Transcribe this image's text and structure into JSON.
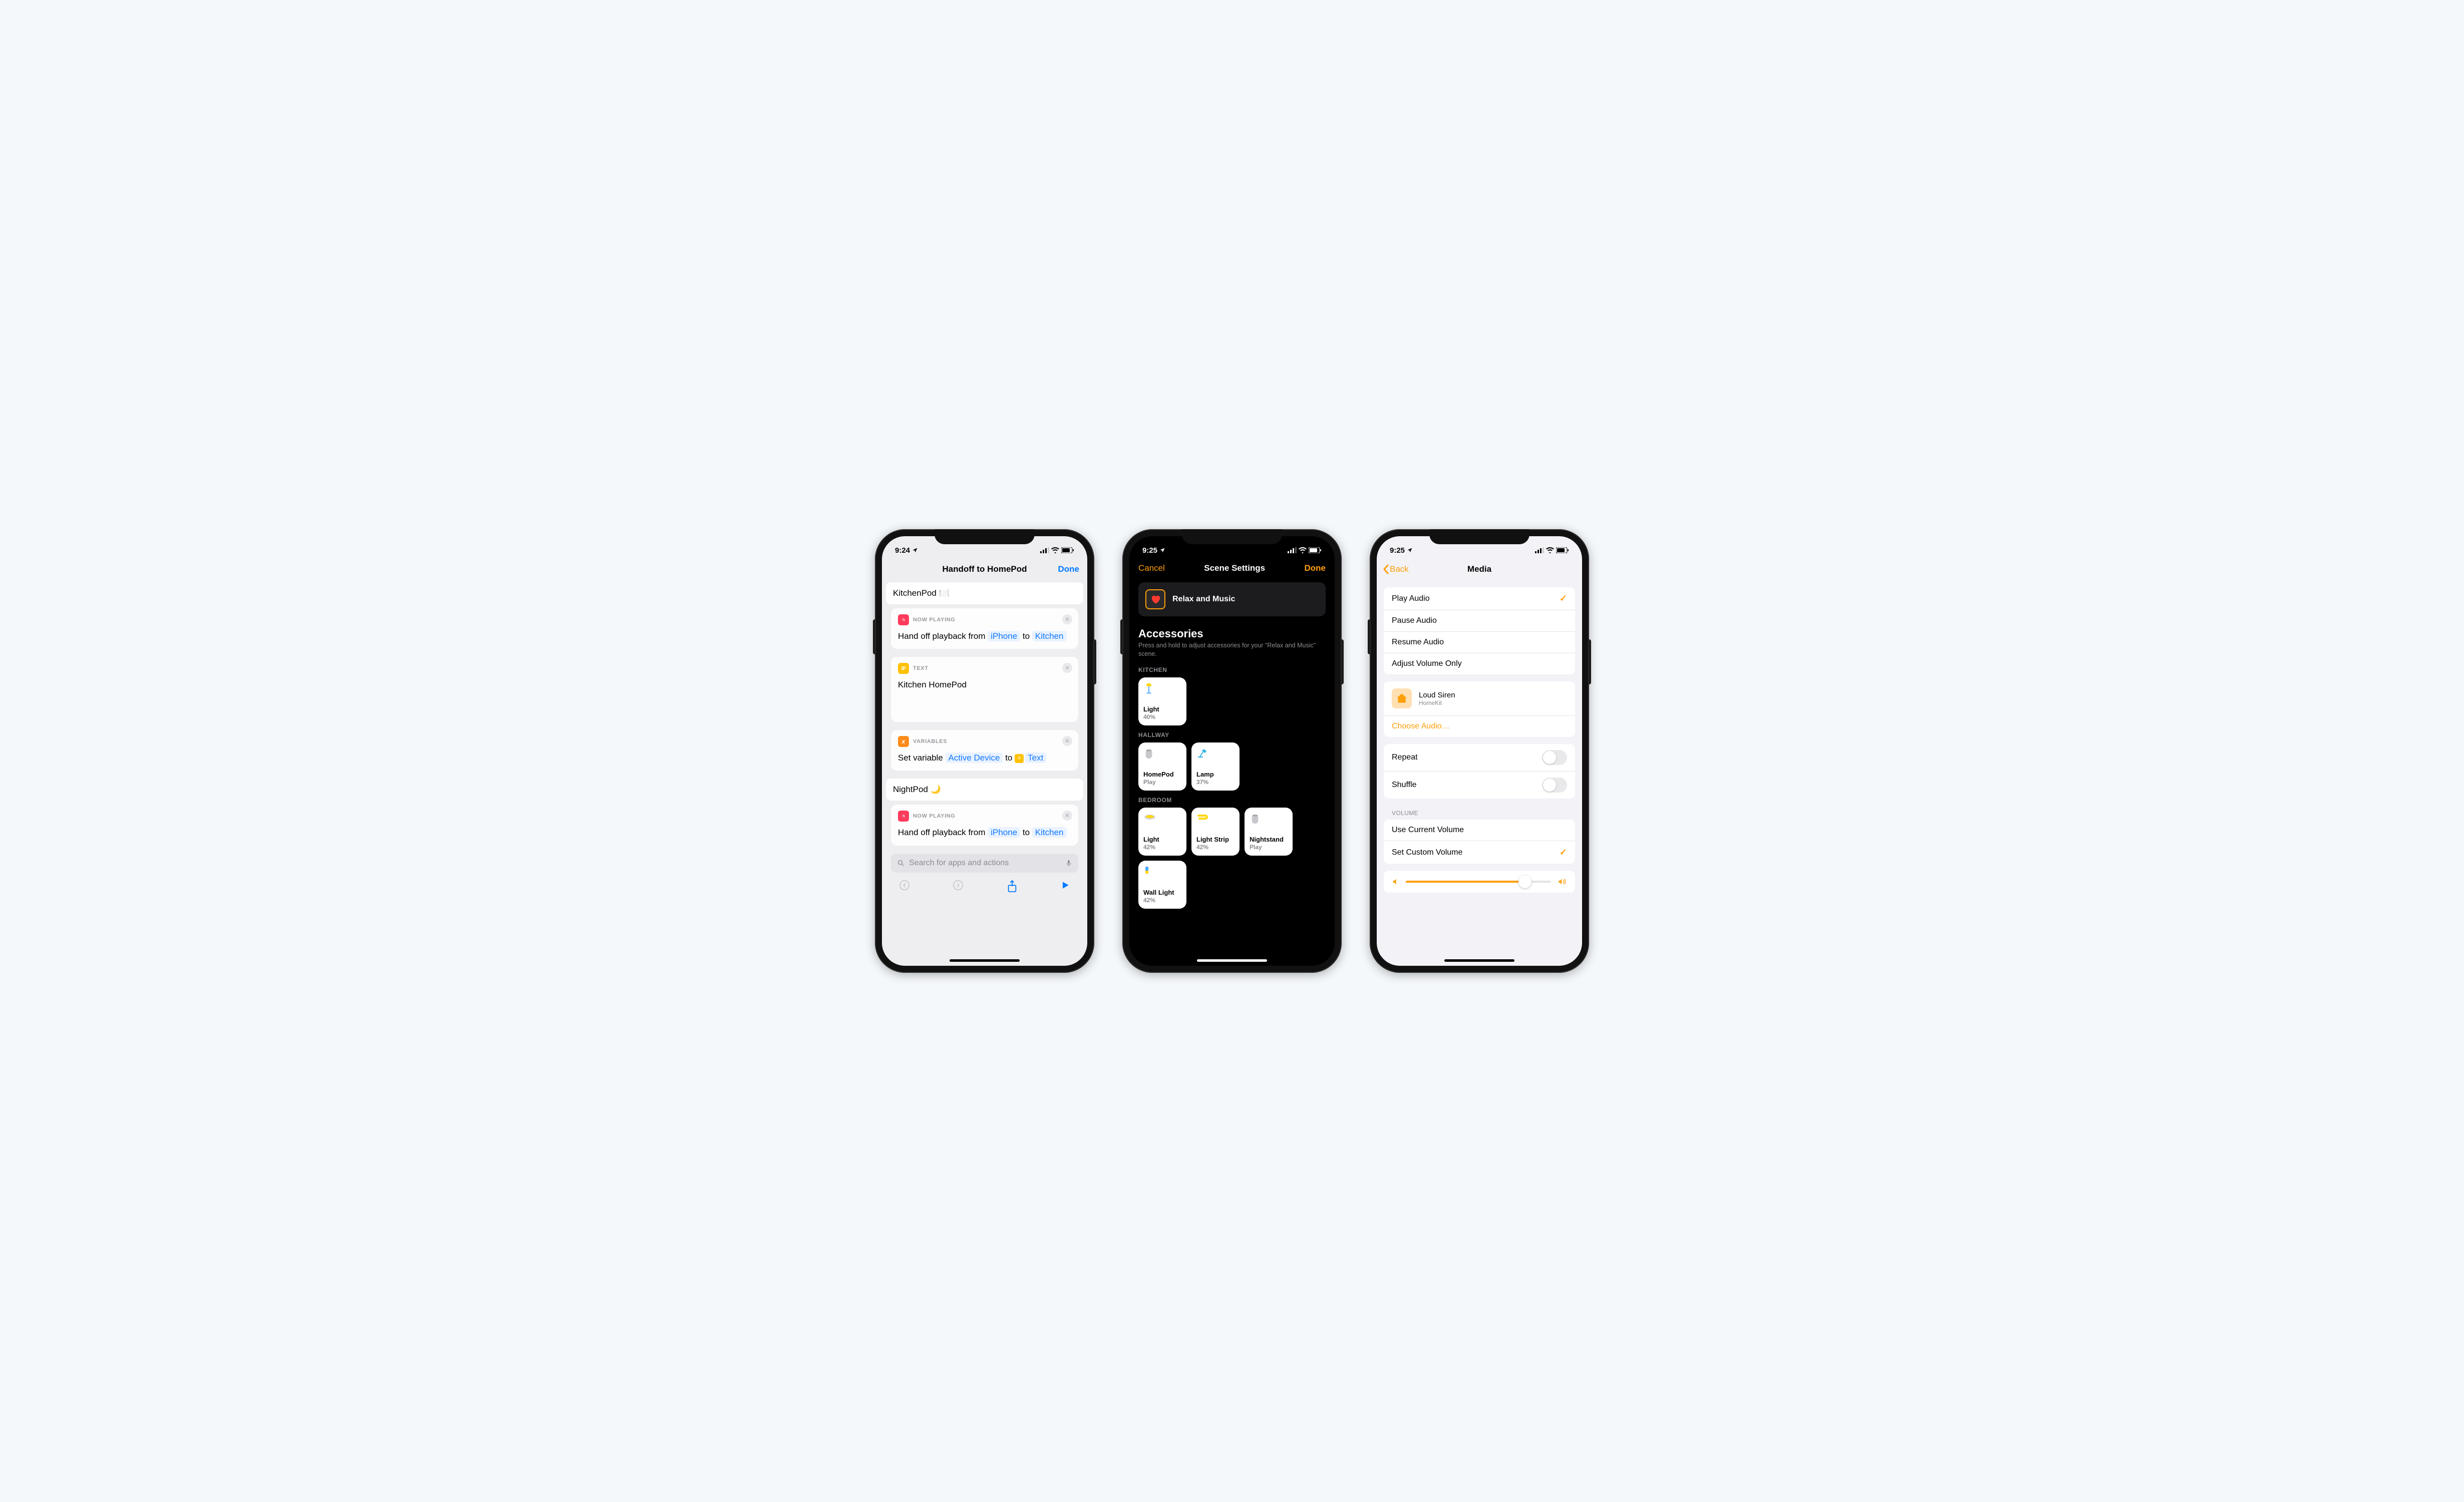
{
  "phone1": {
    "status_time": "9:24",
    "nav_title": "Handoff to HomePod",
    "nav_done": "Done",
    "section1_title": "KitchenPod 🍽️",
    "card_nowplaying_label": "NOW PLAYING",
    "handoff_pre": "Hand off playback from ",
    "handoff_token1": "iPhone",
    "handoff_mid": " to ",
    "handoff_token2": "Kitchen",
    "card_text_label": "TEXT",
    "card_text_body": "Kitchen HomePod",
    "card_variables_label": "VARIABLES",
    "var_pre": "Set variable ",
    "var_token1": "Active Device",
    "var_mid": " to ",
    "var_token2": "Text",
    "section2_title": "NightPod 🌙",
    "search_placeholder": "Search for apps and actions"
  },
  "phone2": {
    "status_time": "9:25",
    "nav_cancel": "Cancel",
    "nav_title": "Scene Settings",
    "nav_done": "Done",
    "scene_name": "Relax and Music",
    "accessories_title": "Accessories",
    "accessories_sub": "Press and hold to adjust accessories for your \"Relax and Music\" scene.",
    "rooms": [
      {
        "label": "KITCHEN",
        "tiles": [
          {
            "name": "Light",
            "state": "40%",
            "icon": "lamp-yellow"
          }
        ]
      },
      {
        "label": "HALLWAY",
        "tiles": [
          {
            "name": "HomePod",
            "state": "Play",
            "icon": "homepod"
          },
          {
            "name": "Lamp",
            "state": "37%",
            "icon": "desk-lamp"
          }
        ]
      },
      {
        "label": "BEDROOM",
        "tiles": [
          {
            "name": "Light",
            "state": "42%",
            "icon": "ceiling"
          },
          {
            "name": "Light Strip",
            "state": "42%",
            "icon": "strip"
          },
          {
            "name": "Nightstand",
            "state": "Play",
            "icon": "homepod-gray"
          },
          {
            "name": "Wall Light",
            "state": "42%",
            "icon": "wall"
          }
        ]
      }
    ]
  },
  "phone3": {
    "status_time": "9:25",
    "nav_back": "Back",
    "nav_title": "Media",
    "actions": [
      "Play Audio",
      "Pause Audio",
      "Resume Audio",
      "Adjust Volume Only"
    ],
    "selected_action": "Play Audio",
    "audio_name": "Loud Siren",
    "audio_source": "HomeKit",
    "choose_audio": "Choose Audio…",
    "repeat": "Repeat",
    "shuffle": "Shuffle",
    "volume_label": "VOLUME",
    "use_current": "Use Current Volume",
    "set_custom": "Set Custom Volume"
  }
}
